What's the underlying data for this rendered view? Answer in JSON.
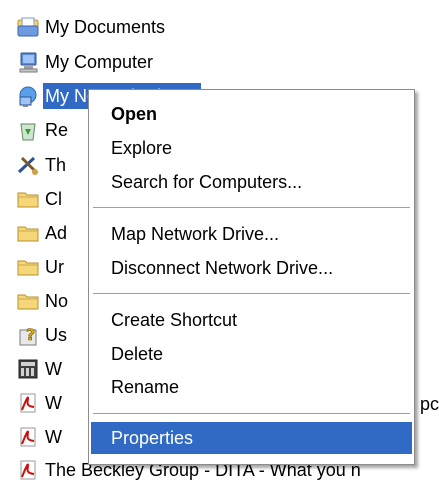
{
  "tree": {
    "items": [
      {
        "label": "My Documents",
        "icon": "my-documents-icon"
      },
      {
        "label": "My Computer",
        "icon": "my-computer-icon"
      },
      {
        "label": "My Network Places",
        "icon": "network-places-icon"
      },
      {
        "label": "Re",
        "icon": "recycle-bin-icon"
      },
      {
        "label": "Th",
        "icon": "tools-icon"
      },
      {
        "label": "Cl",
        "icon": "folder-icon"
      },
      {
        "label": "Ad",
        "icon": "folder-icon"
      },
      {
        "label": "Ur",
        "icon": "folder-icon"
      },
      {
        "label": "No",
        "icon": "folder-icon"
      },
      {
        "label": "Us",
        "icon": "help-icon"
      },
      {
        "label": "W",
        "icon": "app-window-icon"
      },
      {
        "label": "W",
        "icon": "pdf-icon"
      },
      {
        "label": "W",
        "icon": "pdf-icon"
      },
      {
        "label": "The Beckley Group - DITA - What you n",
        "icon": "pdf-icon"
      }
    ],
    "partial_text_right": "pc"
  },
  "context_menu": {
    "items": [
      {
        "label": "Open"
      },
      {
        "label": "Explore"
      },
      {
        "label": "Search for Computers..."
      },
      {
        "label": "Map Network Drive..."
      },
      {
        "label": "Disconnect Network Drive..."
      },
      {
        "label": "Create Shortcut"
      },
      {
        "label": "Delete"
      },
      {
        "label": "Rename"
      },
      {
        "label": "Properties"
      }
    ]
  },
  "colors": {
    "selection": "#316ac5",
    "menu_border": "#8c8c8c",
    "folder": "#f5d77a"
  }
}
